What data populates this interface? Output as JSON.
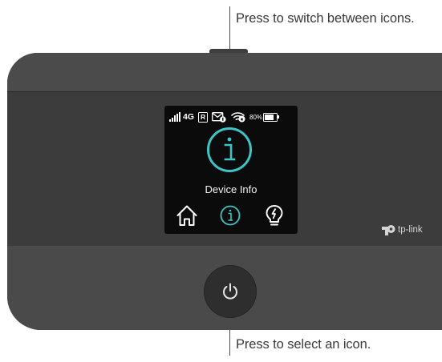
{
  "annotations": {
    "top_button": "Press to switch between icons.",
    "power_button": "Press to select an icon."
  },
  "screen": {
    "status_bar": {
      "network": "4G",
      "roaming": "R",
      "battery_percent": "80%",
      "battery_level": 0.8
    },
    "title": "Device Info",
    "icons": [
      "home-icon",
      "info-icon",
      "lightbulb-icon"
    ],
    "selected_icon": "info-icon"
  },
  "brand": {
    "name": "tp-link"
  },
  "colors": {
    "accent": "#3ec4c4",
    "device_body": "#4a4a4b",
    "screen_bg": "#0b0b0b"
  }
}
